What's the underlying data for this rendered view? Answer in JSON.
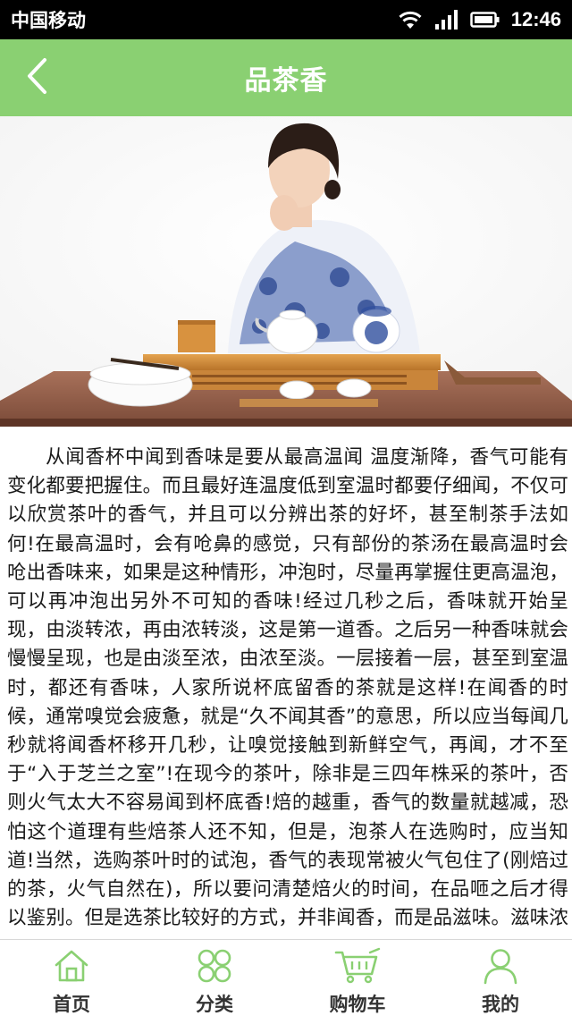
{
  "status_bar": {
    "carrier": "中国移动",
    "time": "12:46"
  },
  "header": {
    "title": "品茶香",
    "back_icon": "chevron-left-icon"
  },
  "hero": {
    "image_name": "tea-ceremony-photo"
  },
  "article": {
    "text": "从闻香杯中闻到香味是要从最高温闻 温度渐降，香气可能有变化都要把握住。而且最好连温度低到室温时都要仔细闻，不仅可以欣赏茶叶的香气，并且可以分辨出茶的好坏，甚至制茶手法如何!在最高温时，会有呛鼻的感觉，只有部份的茶汤在最高温时会呛出香味来，如果是这种情形，冲泡时，尽量再掌握住更高温泡，可以再冲泡出另外不可知的香味!经过几秒之后，香味就开始呈现，由淡转浓，再由浓转淡，这是第一道香。之后另一种香味就会慢慢呈现，也是由淡至浓，由浓至淡。一层接着一层，甚至到室温时，都还有香味，人家所说杯底留香的茶就是这样!在闻香的时候，通常嗅觉会疲惫，就是“久不闻其香”的意思，所以应当每闻几秒就将闻香杯移开几秒，让嗅觉接触到新鲜空气，再闻，才不至于“入于芝兰之室”!在现今的茶叶，除非是三四年株采的茶叶，否则火气太大不容易闻到杯底香!焙的越重，香气的数量就越减，恐怕这个道理有些焙茶人还不知，但是，泡茶人在选购时，应当知道!当然，选购茶叶时的试泡，香气的表现常被火气包住了(刚焙过的茶，火气自然在)，所以要问清楚焙火的时间，在品咂之后才得以鉴别。但是选茶比较好的方式，并非闻香，而是品滋味。滋味浓者，香气在往后的表现会比较好当然，刚制成的茶叶，如果焙火重，香气又足，保持新鲜的感觉(香气会转、滋味会跳、喝了之后会感到鲜活)，当然是等级以上的茶叶!"
  },
  "bottom_nav": {
    "items": [
      {
        "label": "首页",
        "icon": "home-icon"
      },
      {
        "label": "分类",
        "icon": "category-icon"
      },
      {
        "label": "购物车",
        "icon": "cart-icon"
      },
      {
        "label": "我的",
        "icon": "user-icon"
      }
    ]
  },
  "colors": {
    "accent": "#8ad072",
    "status_bar": "#000000",
    "text": "#1a1a1a"
  }
}
